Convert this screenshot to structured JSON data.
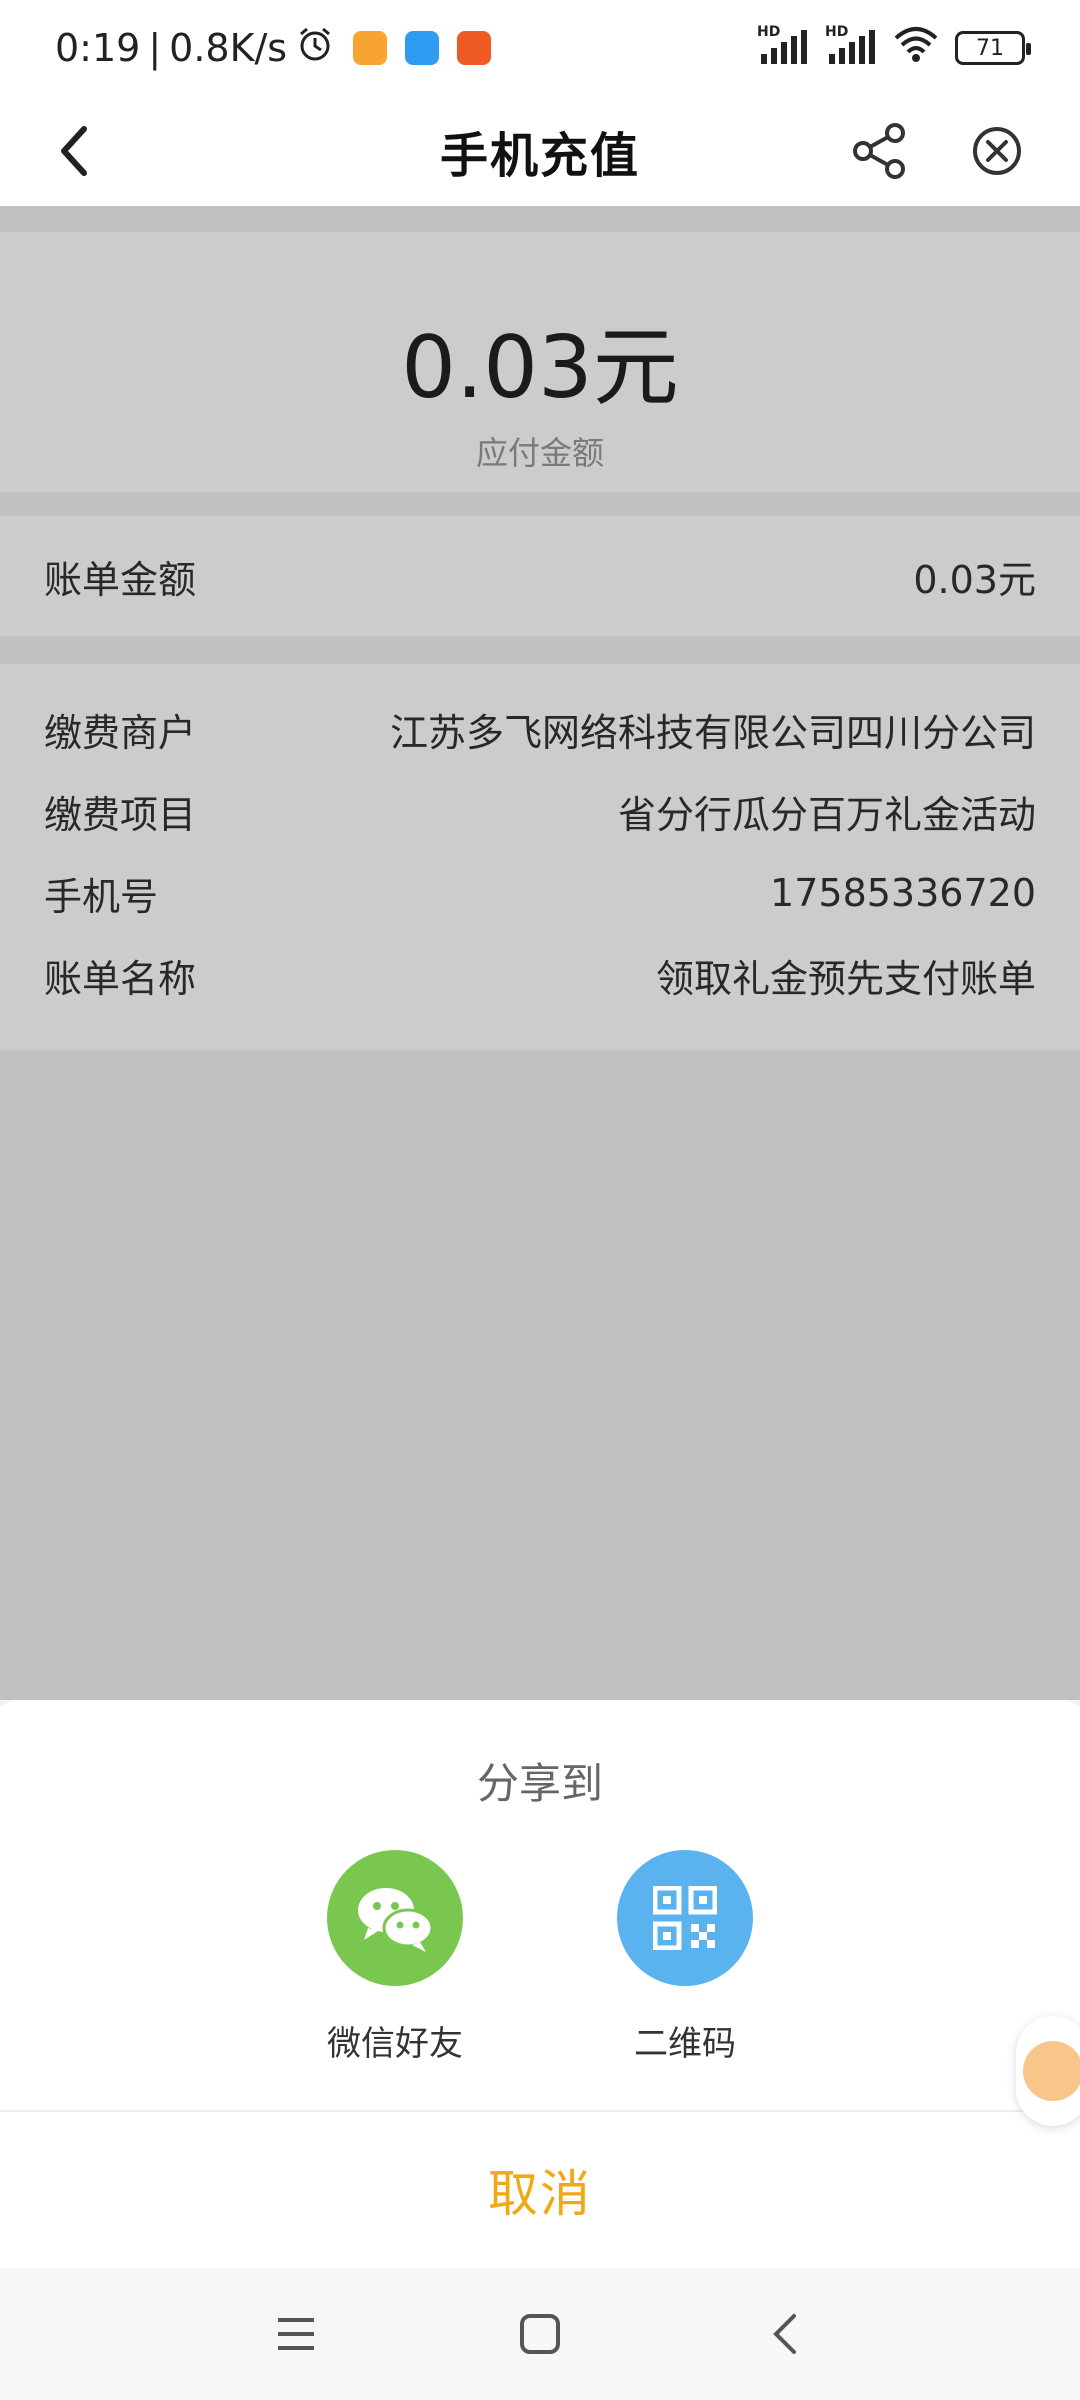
{
  "status_bar": {
    "time": "0:19",
    "speed": "0.8K/s",
    "battery": "71",
    "net_label_1": "HD",
    "net_label_2": "HD"
  },
  "nav": {
    "title": "手机充值"
  },
  "payment": {
    "amount": "0.03元",
    "amount_label": "应付金额"
  },
  "bill": {
    "label": "账单金额",
    "value": "0.03元"
  },
  "details": [
    {
      "label": "缴费商户",
      "value": "江苏多飞网络科技有限公司四川分公司"
    },
    {
      "label": "缴费项目",
      "value": "省分行瓜分百万礼金活动"
    },
    {
      "label": "手机号",
      "value": "17585336720"
    },
    {
      "label": "账单名称",
      "value": "领取礼金预先支付账单"
    }
  ],
  "share_sheet": {
    "title": "分享到",
    "options": [
      {
        "label": "微信好友",
        "icon": "wechat-icon",
        "color": "#7ac74f"
      },
      {
        "label": "二维码",
        "icon": "qrcode-icon",
        "color": "#5ab2ee"
      }
    ],
    "cancel": "取消"
  },
  "colors": {
    "accent": "#f0a817",
    "page_bg": "#f2f2f2"
  }
}
